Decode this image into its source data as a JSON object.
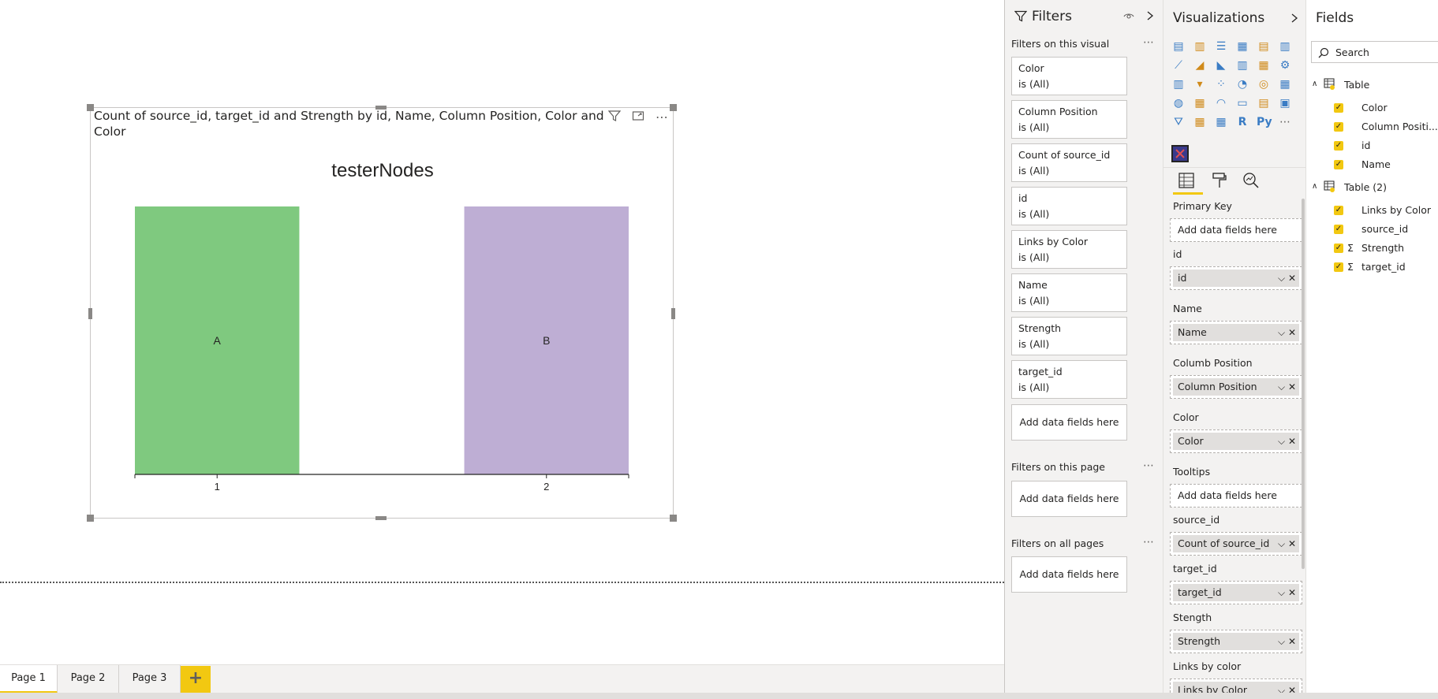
{
  "visual": {
    "title_line1": "Count of source_id, target_id and Strength by id, Name, Column Position, Color and Links by",
    "title_line2": "Color",
    "header_icons": [
      "filter-icon",
      "focus-mode-icon",
      "more-options-icon"
    ],
    "more_glyph": "⋯"
  },
  "chart_data": {
    "type": "bar",
    "title": "testerNodes",
    "categories": [
      "1",
      "2"
    ],
    "bar_labels": [
      "A",
      "B"
    ],
    "colors": [
      "#7fc97f",
      "#beaed4"
    ],
    "values": [
      1,
      1
    ],
    "ylim": [
      0,
      1
    ],
    "grid": false,
    "legend": "none"
  },
  "tabs": [
    {
      "label": "Page 1",
      "active": true
    },
    {
      "label": "Page 2",
      "active": false
    },
    {
      "label": "Page 3",
      "active": false
    }
  ],
  "add_page": "+",
  "filters": {
    "title": "Filters",
    "on_visual_label": "Filters on this visual",
    "dots": "⋯",
    "cards": [
      {
        "name": "Color",
        "value": "is (All)"
      },
      {
        "name": "Column Position",
        "value": "is (All)"
      },
      {
        "name": "Count of source_id",
        "value": "is (All)"
      },
      {
        "name": "id",
        "value": "is (All)"
      },
      {
        "name": "Links by Color",
        "value": "is (All)"
      },
      {
        "name": "Name",
        "value": "is (All)"
      },
      {
        "name": "Strength",
        "value": "is (All)"
      },
      {
        "name": "target_id",
        "value": "is (All)"
      }
    ],
    "add_visual": "Add data fields here",
    "on_page_label": "Filters on this page",
    "add_page": "Add data fields here",
    "all_pages_label": "Filters on all pages",
    "add_all": "Add data fields here"
  },
  "visualizations": {
    "title": "Visualizations",
    "wells": [
      {
        "label": "Primary Key",
        "field": null,
        "placeholder": "Add data fields here"
      },
      {
        "label": "id",
        "field": "id"
      },
      {
        "label": "Name",
        "field": "Name"
      },
      {
        "label": "Columb Position",
        "field": "Column Position"
      },
      {
        "label": "Color",
        "field": "Color"
      },
      {
        "label": "Tooltips",
        "field": null,
        "placeholder": "Add data fields here"
      },
      {
        "label": "source_id",
        "field": "Count of source_id"
      },
      {
        "label": "target_id",
        "field": "target_id"
      },
      {
        "label": "Stength",
        "field": "Strength"
      },
      {
        "label": "Links by color",
        "field": "Links by Color"
      }
    ]
  },
  "fields": {
    "title": "Fields",
    "search_placeholder": "Search",
    "tables": [
      {
        "name": "Table",
        "items": [
          {
            "name": "Color",
            "sigma": false
          },
          {
            "name": "Column Positi...",
            "sigma": false
          },
          {
            "name": "id",
            "sigma": false
          },
          {
            "name": "Name",
            "sigma": false
          }
        ]
      },
      {
        "name": "Table (2)",
        "items": [
          {
            "name": "Links by Color",
            "sigma": false
          },
          {
            "name": "source_id",
            "sigma": false
          },
          {
            "name": "Strength",
            "sigma": true
          },
          {
            "name": "target_id",
            "sigma": true
          }
        ]
      }
    ]
  }
}
